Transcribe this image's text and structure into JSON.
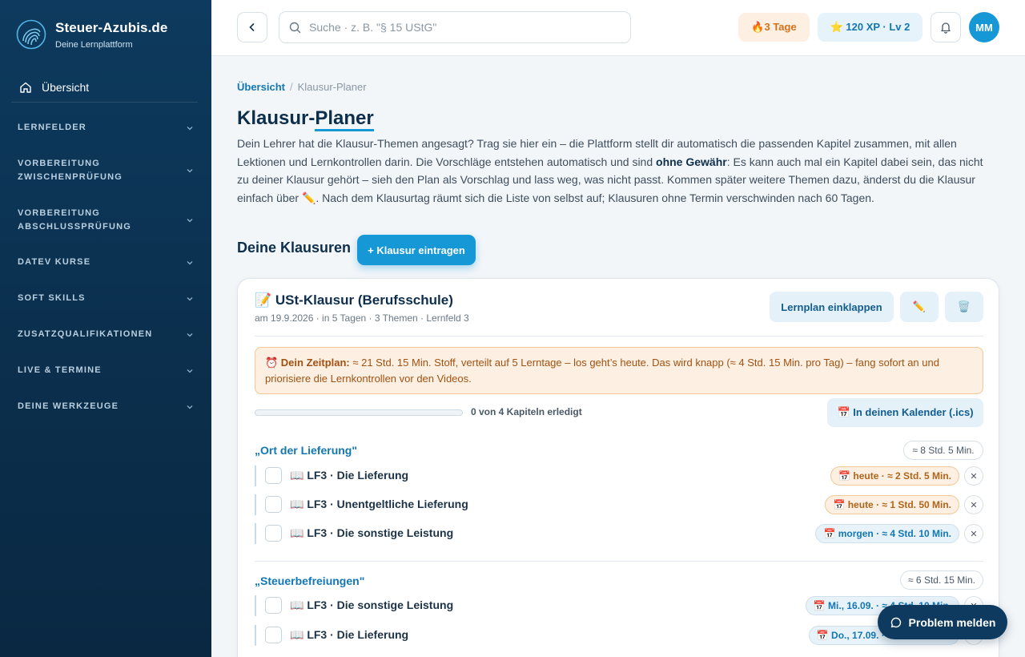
{
  "brand": {
    "name": "Steuer-Azubis.de",
    "tagline": "Deine Lernplattform"
  },
  "sidebar": {
    "home_label": "Übersicht",
    "sections": [
      {
        "label": "LERNFELDER"
      },
      {
        "label": "VORBEREITUNG ZWISCHENPRÜFUNG",
        "line1": "VORBEREITUNG",
        "line2": "ZWISCHENPRÜFUNG"
      },
      {
        "label": "VORBEREITUNG ABSCHLUSSPRÜFUNG",
        "line1": "VORBEREITUNG",
        "line2": "ABSCHLUSSPRÜFUNG"
      },
      {
        "label": "DATEV KURSE"
      },
      {
        "label": "SOFT SKILLS"
      },
      {
        "label": "ZUSATZQUALIFIKATIONEN"
      },
      {
        "label": "LIVE & TERMINE"
      },
      {
        "label": "DEINE WERKZEUGE"
      }
    ]
  },
  "topbar": {
    "search_placeholder": "Suche · z. B. \"§ 15 UStG\"",
    "streak": "🔥3  Tage",
    "xp": "⭐ 120  XP · Lv 2",
    "avatar_initials": "MM"
  },
  "breadcrumb": {
    "home": "Übersicht",
    "separator": "/",
    "current": "Klausur-Planer"
  },
  "page": {
    "title_part1": "Klausur-",
    "title_part2": "Planer",
    "intro_1": "Dein Lehrer hat die Klausur-Themen angesagt? Trag sie hier ein – die Plattform stellt dir automatisch die passenden Kapitel zusammen, mit allen Lektionen und Lernkontrollen darin. Die Vorschläge entstehen automatisch und sind ",
    "intro_bold": "ohne Gewähr",
    "intro_2": ": Es kann auch mal ein Kapitel dabei sein, das nicht zu deiner Klausur gehört – sieh den Plan als Vorschlag und lass weg, was nicht passt. Kommen später weitere Themen dazu, änderst du die Klausur einfach über ✏️. Nach dem Klausurtag räumt sich die Liste von selbst auf; Klausuren ohne Termin verschwinden nach 60 Tagen."
  },
  "exams_section": {
    "title": "Deine Klausuren",
    "add_button": "+ Klausur eintragen"
  },
  "exam": {
    "title": "📝 USt-Klausur (Berufsschule)",
    "meta": "am 19.9.2026 · in 5 Tagen · 3 Themen · Lernfeld 3",
    "collapse_button": "Lernplan einklappen",
    "edit_icon": "✏️",
    "delete_icon": "🗑️",
    "plan_label": "⏰ Dein Zeitplan:",
    "plan_text": " ≈ 21 Std. 15 Min. Stoff, verteilt auf 5 Lerntage – los geht’s heute. Das wird knapp (≈ 4 Std. 15 Min. pro Tag) – fang sofort an und priorisiere die Lernkontrollen vor den Videos.",
    "progress_fraction": 0,
    "progress_label": "0 von 4 Kapiteln erledigt",
    "calendar_button": "📅 In deinen Kalender (.ics)",
    "topics": [
      {
        "title": "„Ort der Lieferung\"",
        "duration": "≈ 8 Std. 5 Min.",
        "lessons": [
          {
            "name": "📖 LF3 · Die Lieferung",
            "when": "📅 heute · ≈ 2 Std. 5 Min.",
            "variant": "warn"
          },
          {
            "name": "📖 LF3 · Unentgeltliche Lieferung",
            "when": "📅 heute · ≈ 1 Std. 50 Min.",
            "variant": "warn"
          },
          {
            "name": "📖 LF3 · Die sonstige Leistung",
            "when": "📅 morgen · ≈ 4 Std. 10 Min.",
            "variant": "info"
          }
        ]
      },
      {
        "title": "„Steuerbefreiungen\"",
        "duration": "≈ 6 Std. 15 Min.",
        "lessons": [
          {
            "name": "📖 LF3 · Die sonstige Leistung",
            "when": "📅 Mi., 16.09. · ≈ 4 Std. 10 Min.",
            "variant": "info"
          },
          {
            "name": "📖 LF3 · Die Lieferung",
            "when": "📅 Do., 17.09. · ≈ 2 Std. 5 Min.",
            "variant": "info"
          }
        ]
      }
    ],
    "remove_icon": "✕"
  },
  "problem_button": "Problem melden",
  "colors": {
    "accent": "#1798d6",
    "sidebar": "#0d3a5e",
    "warn_bg": "#fdf0e2",
    "warn_text": "#a15212"
  }
}
